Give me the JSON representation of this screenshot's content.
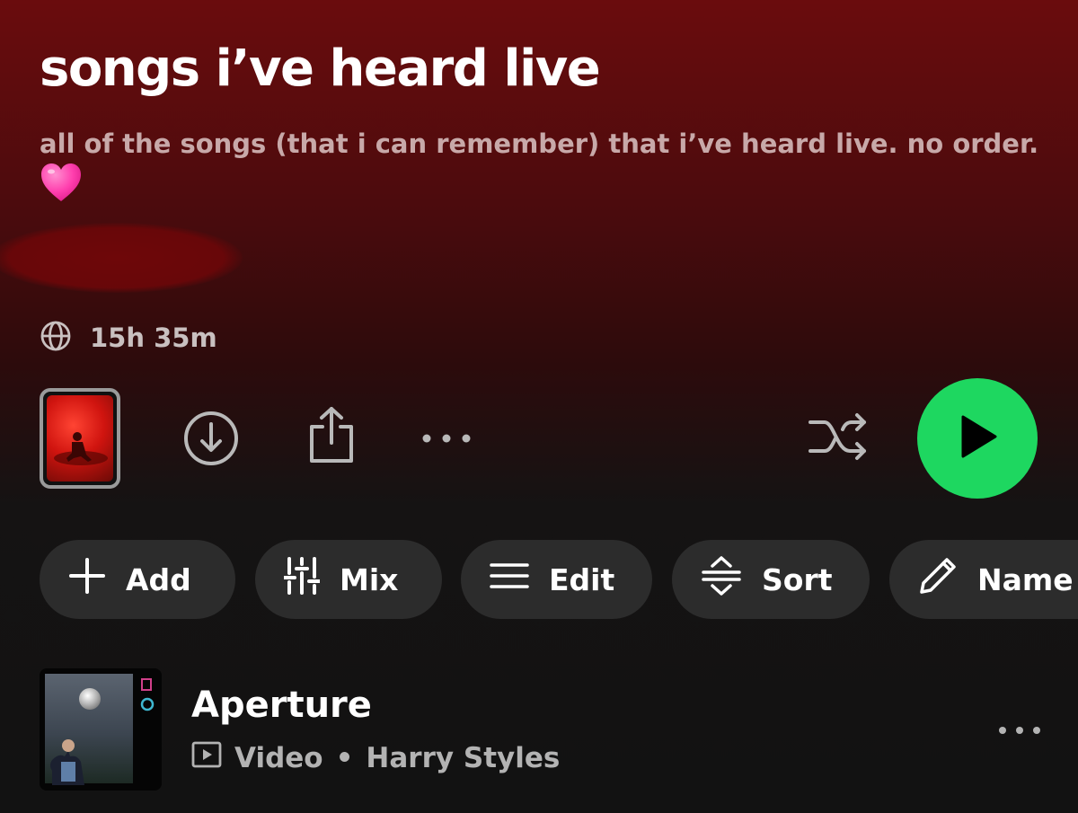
{
  "playlist": {
    "title": "songs i’ve heard live",
    "description": "all of the songs (that i can remember) that i’ve heard live. no order.",
    "duration": "15h 35m"
  },
  "icons": {
    "heart": "pink-heart-emoji",
    "globe": "globe-icon",
    "download": "download-circle-icon",
    "share": "share-icon",
    "more": "more-horizontal-icon",
    "shuffle": "shuffle-icon",
    "play": "play-icon"
  },
  "colors": {
    "accent": "#1ed760",
    "header_red": "#6a0c0d",
    "background": "#121212",
    "chip": "#2c2c2c",
    "heart": "#ff3fae"
  },
  "chips": {
    "add": "Add",
    "mix": "Mix",
    "edit": "Edit",
    "sort": "Sort",
    "name": "Name"
  },
  "tracks": [
    {
      "title": "Aperture",
      "type": "Video",
      "separator": "•",
      "artist": "Harry Styles"
    }
  ]
}
